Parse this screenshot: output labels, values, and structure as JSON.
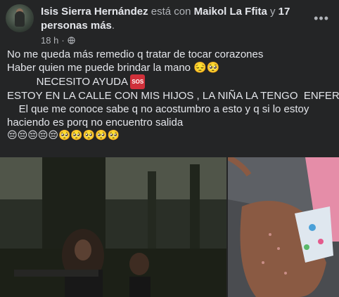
{
  "post": {
    "author": "Isis Sierra Hernández",
    "with_text": "está con",
    "tagged": "Maikol La Ffita",
    "and_text": "y",
    "others": "17 personas más",
    "period": ".",
    "time": "18 h",
    "dot": "·",
    "lines": [
      "No me queda más remedio q tratar de tocar corazones",
      "Haber quien me puede brindar la mano 😔🥺",
      "          NECESITO AYUDA",
      "ESTOY EN LA CALLE CON MIS HIJOS , LA NIÑA LA TENGO  ENFERMA",
      "    El que me conoce sabe q no acostumbro a esto y q si lo estoy",
      "haciendo es porq no encuentro salida",
      "😔😔😔😔😔🥺🥺🥺🥺🥺"
    ],
    "sos_badge": "SOS"
  },
  "icons": {
    "privacy": "globe-icon",
    "menu": "more-horizontal-icon"
  }
}
